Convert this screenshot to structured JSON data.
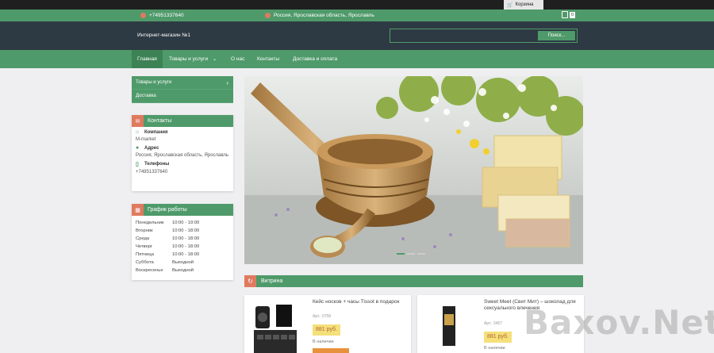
{
  "topbar": {
    "cart_label": "Корзина"
  },
  "infobar": {
    "phone": "+74951337640",
    "location": "Россия, Ярославская область, Ярославль",
    "cart_count": "0"
  },
  "header": {
    "shop_name": "Интернет-магазин №1",
    "search_button": "Поиск..."
  },
  "nav": {
    "items": [
      "Главная",
      "Товары и услуги",
      "О нас",
      "Контакты",
      "Доставка и оплата"
    ]
  },
  "sidebar_menu": {
    "items": [
      "Товары и услуги",
      "Доставка"
    ]
  },
  "contacts": {
    "title": "Контакты",
    "company_label": "Компания",
    "company": "M-market",
    "address_label": "Адрес",
    "address": "Россия, Ярославская область, Ярославль",
    "phones_label": "Телефоны",
    "phone": "+74951337640"
  },
  "schedule": {
    "title": "График работы",
    "rows": [
      {
        "day": "Понедельник",
        "time": "10:00 - 19:00"
      },
      {
        "day": "Вторник",
        "time": "10:00 - 18:00"
      },
      {
        "day": "Среда",
        "time": "10:00 - 18:00"
      },
      {
        "day": "Четверг",
        "time": "10:00 - 18:00"
      },
      {
        "day": "Пятница",
        "time": "10:00 - 18:00"
      },
      {
        "day": "Суббота",
        "time": "Выходной"
      },
      {
        "day": "Воскресенье",
        "time": "Выходной"
      }
    ]
  },
  "vitrina": {
    "title": "Витрина"
  },
  "products": [
    {
      "title": "Кейс носков + часы Tissot в подарок",
      "article": "Арт.: 0758",
      "price": "881 руб.",
      "stock": "В наличии"
    },
    {
      "title": "Sweet Meet (Свит Мит) – шоколад для сексуального влечения",
      "article": "Арт.: 3457",
      "price": "881 руб.",
      "stock": "В наличии"
    }
  ],
  "watermark": "Baxov.Net",
  "colors": {
    "accent": "#4f9a6a",
    "header_bg": "#2e3a43",
    "icon_accent": "#e07a5f",
    "price_bg": "#f5e079"
  }
}
